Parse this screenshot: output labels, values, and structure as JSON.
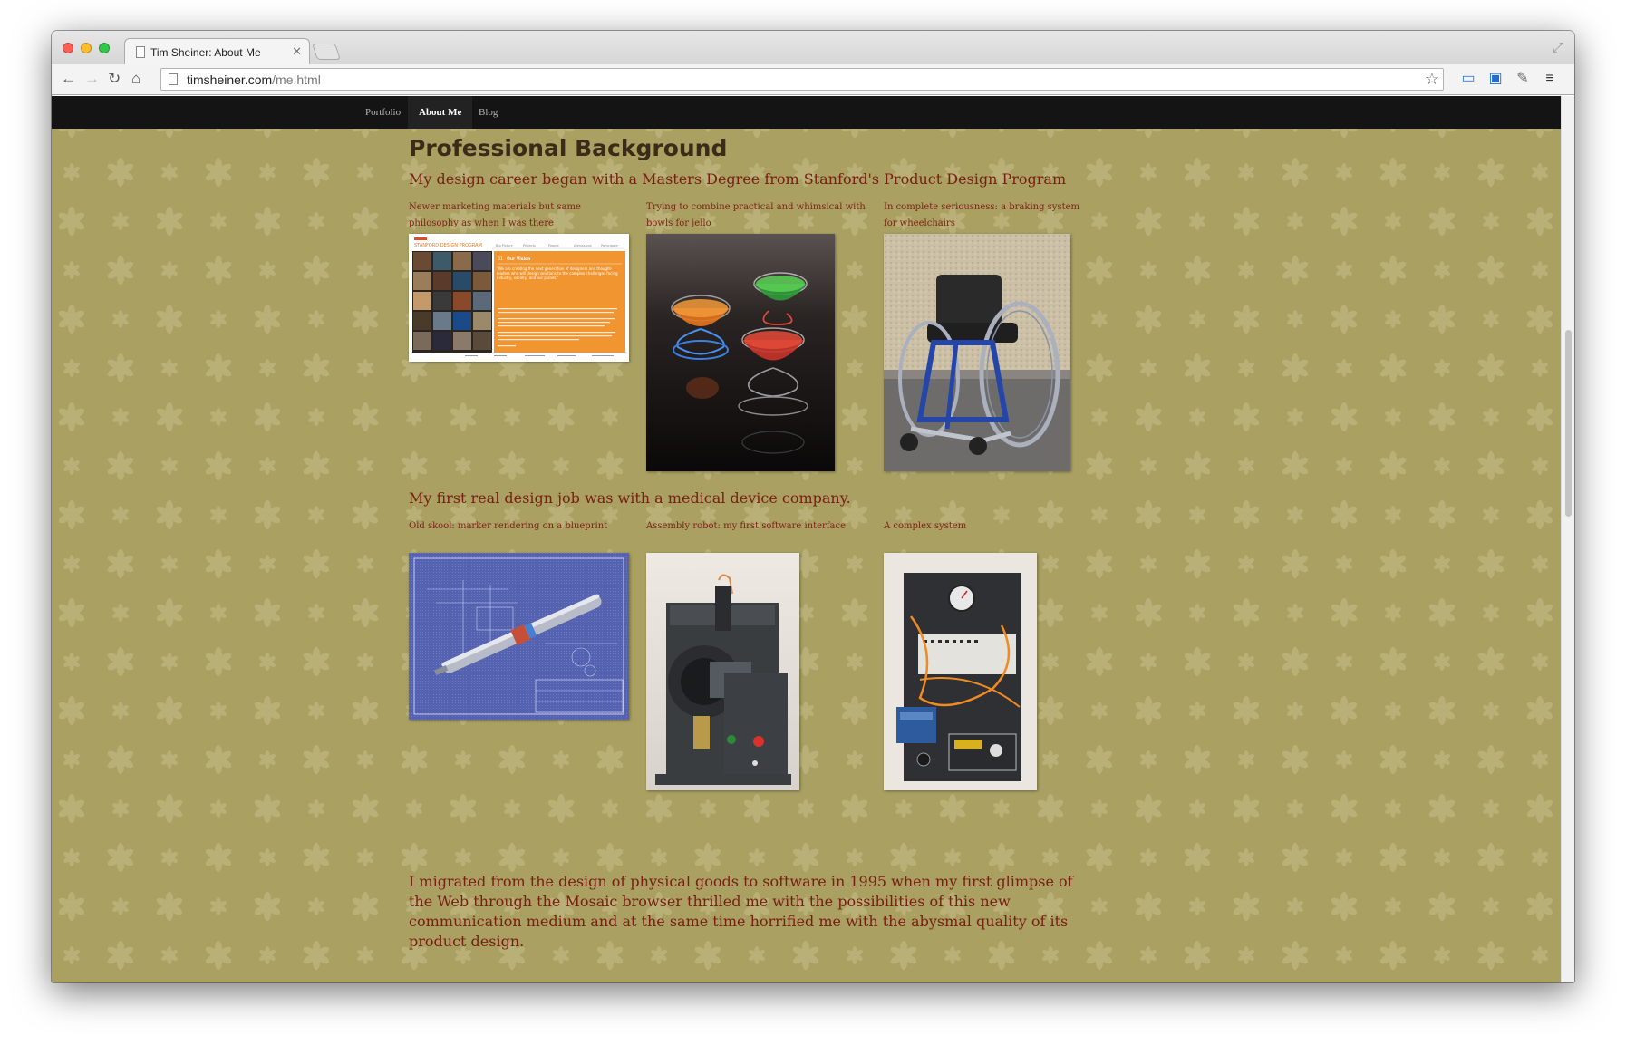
{
  "browser": {
    "tab_title": "Tim Sheiner: About Me",
    "url_domain": "timsheiner.com",
    "url_path": "/me.html"
  },
  "nav": {
    "items": [
      {
        "label": "Portfolio",
        "active": false
      },
      {
        "label": "About Me",
        "active": true
      },
      {
        "label": "Blog",
        "active": false
      }
    ]
  },
  "colors": {
    "page_bg": "#a9a062",
    "accent_text": "#7a1d13",
    "heading_text": "#3a2c18",
    "nav_bg": "#141414"
  },
  "main": {
    "heading": "Professional Background",
    "section1": {
      "lead": "My design career began with a Masters Degree from Stanford's Product Design Program",
      "items": [
        {
          "caption": "Newer marketing materials but same philosophy as when I was there",
          "image": "stanford-design-program-brochure"
        },
        {
          "caption": "Trying to combine practical and whimsical with bowls for jello",
          "image": "jello-bowls-photo"
        },
        {
          "caption": "In complete seriousness: a braking system for wheelchairs",
          "image": "wheelchair-photo"
        }
      ]
    },
    "section2": {
      "lead": "My first real design job was with a medical device company.",
      "items": [
        {
          "caption": "Old skool: marker rendering on a blueprint",
          "image": "blueprint-rendering"
        },
        {
          "caption": "Assembly robot: my first software interface",
          "image": "assembly-robot-photo"
        },
        {
          "caption": "A complex system",
          "image": "complex-system-photo"
        }
      ]
    },
    "paragraph": "I migrated from the design of physical goods to software in 1995 when my first glimpse of the Web through the Mosaic browser thrilled me with the possibilities of this new communication medium and at the same time horrified me with the abysmal quality of its product design."
  },
  "brochure": {
    "brand": "STANFORD DESIGN PROGRAM",
    "tabs": [
      "Big Picture",
      "Projects",
      "People",
      "Admissions",
      "Participate"
    ],
    "vision_title": "Our Vision",
    "vision_quote": "\"We are creating the next generation of designers and thought-leaders who will design solutions to the complex challenges facing industry, society, and our planet.\""
  }
}
